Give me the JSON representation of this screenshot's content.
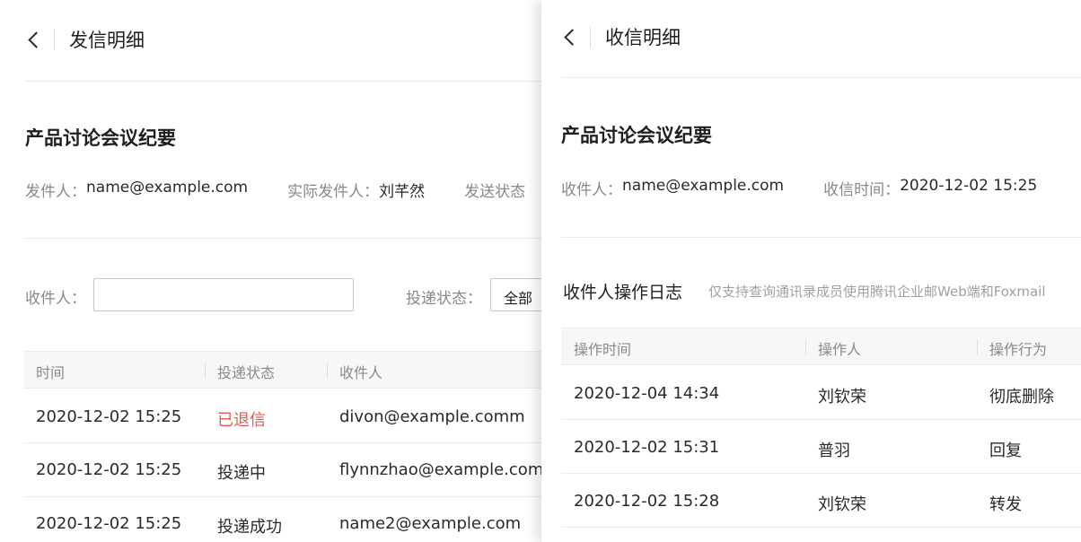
{
  "sent": {
    "title": "发信明细",
    "subject": "产品讨论会议纪要",
    "meta": [
      {
        "label": "发件人：",
        "value": "name@example.com"
      },
      {
        "label": "实际发件人：",
        "value": "刘芊然"
      },
      {
        "label": "发送状态",
        "value": ""
      }
    ],
    "filter": {
      "recipient_label": "收件人：",
      "recipient_value": "",
      "status_label": "投递状态：",
      "status_value": "全部"
    },
    "columns": [
      "时间",
      "投递状态",
      "收件人"
    ],
    "rows": [
      {
        "time": "2020-12-02 15:25",
        "status": "已退信",
        "recipient": "divon@example.comm"
      },
      {
        "time": "2020-12-02 15:25",
        "status": "投递中",
        "recipient": "flynnzhao@example.com"
      },
      {
        "time": "2020-12-02 15:25",
        "status": "投递成功",
        "recipient": "name2@example.com"
      }
    ],
    "colors": {
      "bounced": "#e25b4f"
    }
  },
  "received": {
    "title": "收信明细",
    "subject": "产品讨论会议纪要",
    "meta": [
      {
        "label": "收件人：",
        "value": "name@example.com"
      },
      {
        "label": "收信时间：",
        "value": "2020-12-02 15:25"
      }
    ],
    "log_title": "收件人操作日志",
    "log_note": "仅支持查询通讯录成员使用腾讯企业邮Web端和Foxmail",
    "columns": [
      "操作时间",
      "操作人",
      "操作行为"
    ],
    "rows": [
      {
        "time": "2020-12-04 14:34",
        "operator": "刘钦荣",
        "action": "彻底删除"
      },
      {
        "time": "2020-12-02 15:31",
        "operator": "普羽",
        "action": "回复"
      },
      {
        "time": "2020-12-02 15:28",
        "operator": "刘钦荣",
        "action": "转发"
      }
    ]
  }
}
